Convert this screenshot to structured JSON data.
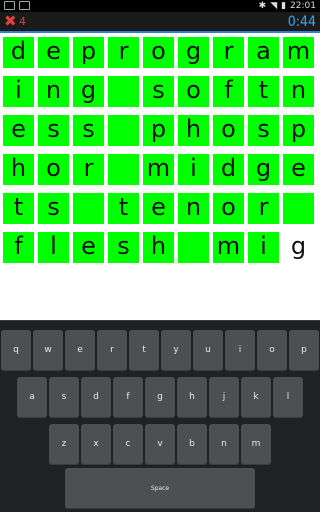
{
  "status_bar": {
    "left_icons": [
      "notification-icon",
      "image-icon"
    ],
    "time": "22:01",
    "icons": [
      "bluetooth-icon",
      "wifi-icon",
      "battery-icon"
    ]
  },
  "action_bar": {
    "miss_icon": "close-x-icon",
    "miss_count": "4",
    "timer": "0:44",
    "colors": {
      "miss": "#e04040",
      "timer": "#33aaff",
      "rule": "#2c7fd4"
    }
  },
  "puzzle": {
    "cell_color": "#00ff00",
    "rows": [
      [
        "d",
        "e",
        "p",
        "r",
        "o",
        "g",
        "r",
        "a",
        "m"
      ],
      [
        "i",
        "n",
        "g",
        "",
        "s",
        "o",
        "f",
        "t",
        "n"
      ],
      [
        "e",
        "s",
        "s",
        "",
        "p",
        "h",
        "o",
        "s",
        "p"
      ],
      [
        "h",
        "o",
        "r",
        "",
        "m",
        "i",
        "d",
        "g",
        "e"
      ],
      [
        "t",
        "s",
        "",
        "t",
        "e",
        "n",
        "o",
        "r",
        ""
      ],
      [
        "f",
        "l",
        "e",
        "s",
        "h",
        "",
        "m",
        "i",
        "g"
      ]
    ],
    "empty_white": [
      [
        5,
        8
      ]
    ]
  },
  "keyboard": {
    "row1": [
      "q",
      "w",
      "e",
      "r",
      "t",
      "y",
      "u",
      "i",
      "o",
      "p"
    ],
    "row2": [
      "a",
      "s",
      "d",
      "f",
      "g",
      "h",
      "j",
      "k",
      "l"
    ],
    "row3": [
      "z",
      "x",
      "c",
      "v",
      "b",
      "n",
      "m"
    ],
    "space_label": "Space"
  }
}
